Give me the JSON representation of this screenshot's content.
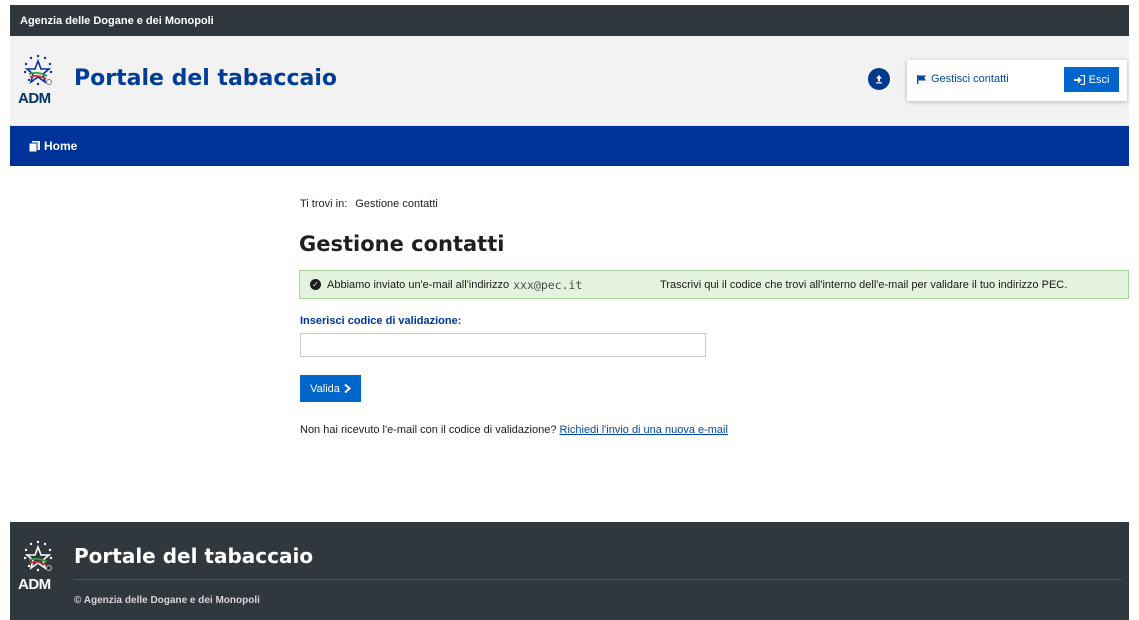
{
  "topbar": {
    "agency": "Agenzia delle Dogane e dei Monopoli"
  },
  "header": {
    "logo_text": "ADM",
    "site_title": "Portale del tabaccaio",
    "manage_contacts_label": "Gestisci contatti",
    "logout_label": "Esci"
  },
  "nav": {
    "home_label": "Home"
  },
  "breadcrumb": {
    "prefix": "Ti trovi in:",
    "current": "Gestione contatti"
  },
  "main": {
    "title": "Gestione contatti",
    "alert": {
      "message": "Abbiamo inviato un'e-mail all'indirizzo",
      "email": "xxx@pec.it",
      "instruction": "Trascrivi qui il codice che trovi all'interno dell'e-mail per validare il tuo indirizzo PEC."
    },
    "code_label": "Inserisci codice di validazione:",
    "code_value": "",
    "validate_label": "Valida",
    "resend_text": "Non hai ricevuto l'e-mail con il codice di validazione?",
    "resend_link": "Richiedi l'invio di una nuova e-mail"
  },
  "footer": {
    "logo_text": "ADM",
    "title": "Portale del tabaccaio",
    "copyright": "© Agenzia delle Dogane e dei Monopoli"
  },
  "colors": {
    "nav_blue": "#003399",
    "button_blue": "#0066cc",
    "dark_bar": "#30373d",
    "alert_bg": "#e4f3de"
  }
}
